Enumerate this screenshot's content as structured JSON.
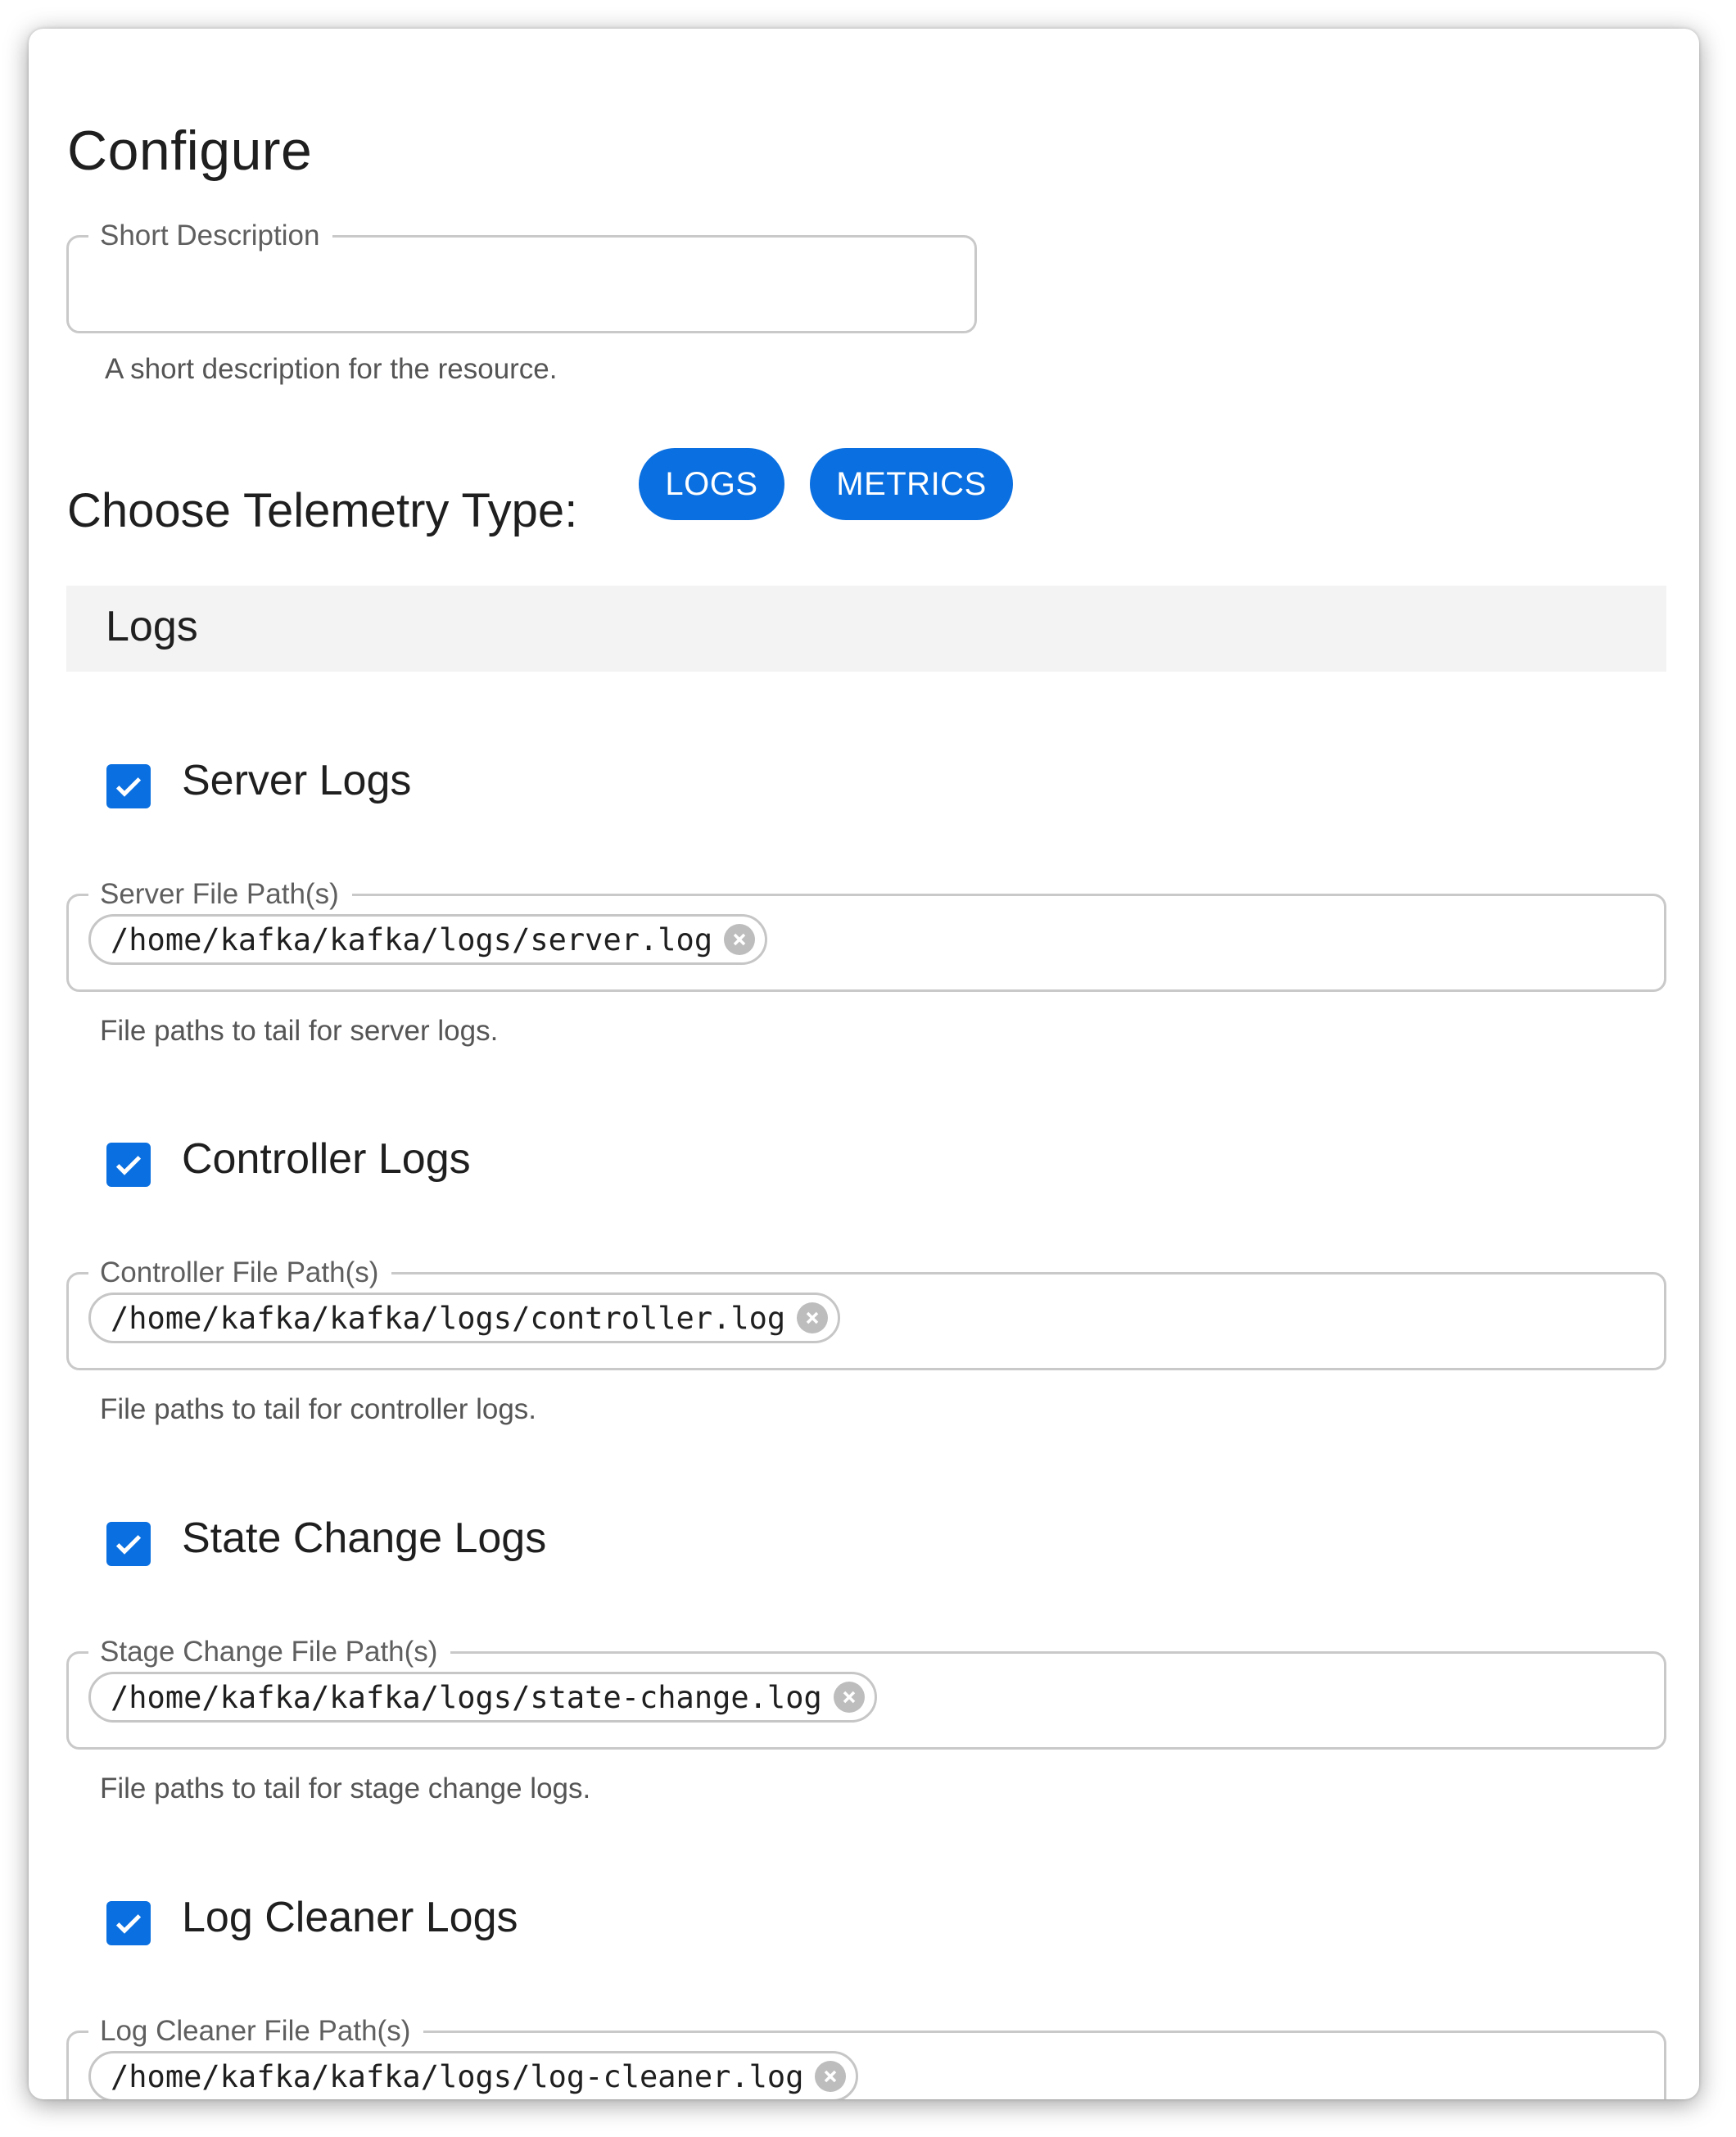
{
  "page": {
    "title": "Configure"
  },
  "short_description": {
    "label": "Short Description",
    "value": "",
    "helper": "A short description for the resource."
  },
  "telemetry": {
    "label": "Choose Telemetry Type:",
    "options": [
      "LOGS",
      "METRICS"
    ]
  },
  "section": {
    "title": "Logs"
  },
  "log_types": [
    {
      "name": "Server Logs",
      "checked": true,
      "field_label": "Server File Path(s)",
      "paths": [
        "/home/kafka/kafka/logs/server.log"
      ],
      "helper": "File paths to tail for server logs."
    },
    {
      "name": "Controller Logs",
      "checked": true,
      "field_label": "Controller File Path(s)",
      "paths": [
        "/home/kafka/kafka/logs/controller.log"
      ],
      "helper": "File paths to tail for controller logs."
    },
    {
      "name": "State Change Logs",
      "checked": true,
      "field_label": "Stage Change File Path(s)",
      "paths": [
        "/home/kafka/kafka/logs/state-change.log"
      ],
      "helper": "File paths to tail for stage change logs."
    },
    {
      "name": "Log Cleaner Logs",
      "checked": true,
      "field_label": "Log Cleaner File Path(s)",
      "paths": [
        "/home/kafka/kafka/logs/log-cleaner.log"
      ],
      "helper": ""
    }
  ],
  "colors": {
    "accent": "#0a6fe0",
    "section_bg": "#f3f3f3",
    "border": "#c9c9c9"
  },
  "icons": {
    "checkbox": "check-icon",
    "chip_remove": "close-circle-icon"
  }
}
